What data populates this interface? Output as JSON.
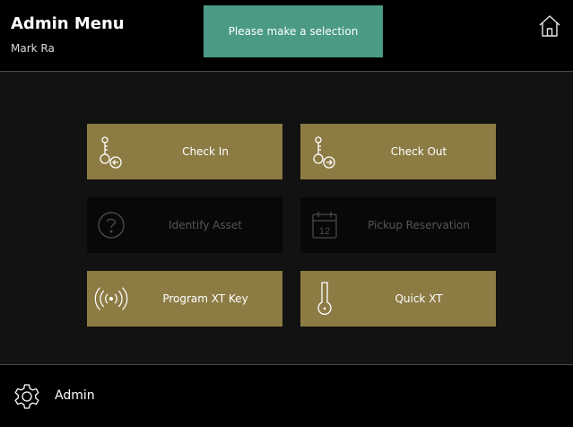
{
  "header": {
    "title": "Admin Menu",
    "user": "Mark Ra",
    "home_icon": "home-icon"
  },
  "toast": {
    "message": "Please make a selection"
  },
  "menu": {
    "check_in": {
      "label": "Check In",
      "icon": "key-check-in-icon",
      "enabled": true
    },
    "check_out": {
      "label": "Check Out",
      "icon": "key-check-out-icon",
      "enabled": true
    },
    "identify_asset": {
      "label": "Identify Asset",
      "icon": "question-circle-icon",
      "enabled": false
    },
    "pickup_reservation": {
      "label": "Pickup Reservation",
      "icon": "calendar-icon",
      "calendar_day": "12",
      "enabled": false
    },
    "program_xt_key": {
      "label": "Program XT Key",
      "icon": "wireless-signal-icon",
      "enabled": true
    },
    "quick_xt": {
      "label": "Quick XT",
      "icon": "key-icon",
      "enabled": true
    }
  },
  "footer": {
    "admin_label": "Admin",
    "icon": "gear-icon"
  },
  "colors": {
    "button_active": "#8c7c44",
    "button_disabled": "#080808",
    "toast": "#4a9a86",
    "background": "#000000",
    "content_bg": "#121212"
  }
}
